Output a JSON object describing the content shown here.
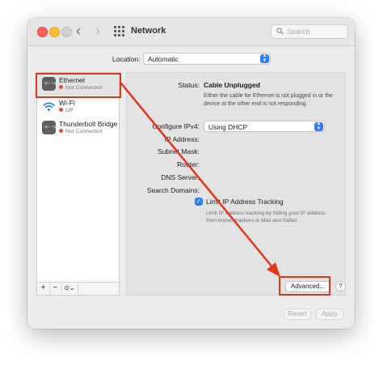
{
  "window": {
    "title": "Network",
    "nav_back": "‹",
    "nav_forward": "›",
    "search_placeholder": "Search"
  },
  "location": {
    "label": "Location:",
    "value": "Automatic"
  },
  "sidebar": {
    "services": [
      {
        "name": "Ethernet",
        "status": "Not Connected",
        "icon": "ethernet-icon",
        "status_color": "#f1443a",
        "selected": true
      },
      {
        "name": "Wi-Fi",
        "status": "Off",
        "icon": "wifi-icon",
        "status_color": "#f1443a"
      },
      {
        "name": "Thunderbolt Bridge",
        "status": "Not Connected",
        "icon": "thunderbolt-bridge-icon",
        "status_color": "#f1443a"
      }
    ],
    "toolbar": {
      "add": "+",
      "remove": "−",
      "action": "⊙⌄"
    }
  },
  "detail": {
    "status_label": "Status:",
    "status_value": "Cable Unplugged",
    "status_description": "Either the cable for Ethernet is not plugged in or the device at the other end is not responding.",
    "configure_label": "Configure IPv4:",
    "configure_value": "Using DHCP",
    "ip_label": "IP Address:",
    "subnet_label": "Subnet Mask:",
    "router_label": "Router:",
    "dns_label": "DNS Server:",
    "search_domains_label": "Search Domains:",
    "limit_tracking_label": "Limit IP Address Tracking",
    "limit_tracking_checked": true,
    "limit_tracking_desc": "Limit IP address tracking by hiding your IP address from known trackers in Mail and Safari.",
    "advanced_label": "Advanced...",
    "help_label": "?"
  },
  "footer": {
    "revert_label": "Revert",
    "apply_label": "Apply"
  },
  "annotation": {
    "color": "#e0361c"
  },
  "colors": {
    "accent": "#2f7cf6",
    "status_red": "#f1443a"
  }
}
